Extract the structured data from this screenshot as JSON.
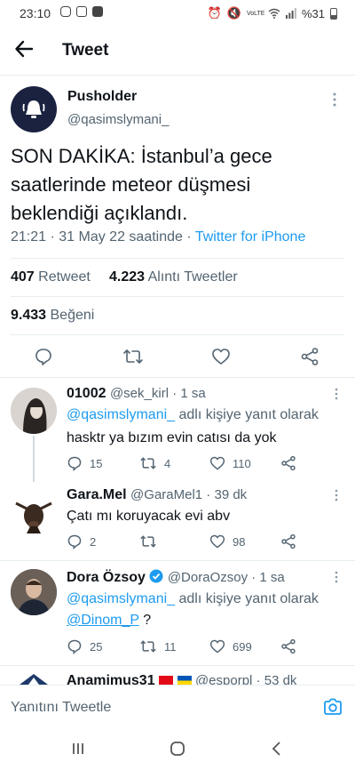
{
  "status_bar": {
    "time": "23:10",
    "network": "VoLTE",
    "battery": "%31"
  },
  "header": {
    "title": "Tweet"
  },
  "tweet": {
    "author_name": "Pusholder",
    "author_handle": "@qasimslymani_",
    "text": "SON DAKİKA: İstanbul’a gece saatlerinde meteor düşmesi beklendiği açıklandı.",
    "time_date": "21:21 · 31 May 22 saatinde · ",
    "source": "Twitter for iPhone",
    "retweets_count": "407",
    "retweets_label": "Retweet",
    "quotes_count": "4.223",
    "quotes_label": "Alıntı Tweetler",
    "likes_count": "9.433",
    "likes_label": "Beğeni"
  },
  "replies": [
    {
      "name": "01002",
      "handle": "@sek_kirl",
      "time": " · 1 sa",
      "reply_to_mention": "@qasimslymani_",
      "reply_to_suffix": " adlı kişiye yanıt olarak",
      "text": "hasktr ya bızım evin catısı da yok",
      "replies": "15",
      "retweets": "4",
      "likes": "110"
    },
    {
      "name": "Gara.Mel",
      "handle": "@GaraMel1",
      "time": " · 39 dk",
      "text": "Çatı mı koruyacak evi abv",
      "replies": "2",
      "retweets": "",
      "likes": "98"
    },
    {
      "name": "Dora Özsoy",
      "handle": "@DoraOzsoy",
      "time": " · 1 sa",
      "reply_to_mention": "@qasimslymani_",
      "reply_to_suffix": " adlı kişiye yanıt olarak",
      "mention2": "@Dinom_P",
      "text_suffix": " ?",
      "replies": "25",
      "retweets": "11",
      "likes": "699"
    },
    {
      "name": "Anamimus31",
      "handle": "@esporpl",
      "time": " · 53 dk"
    }
  ],
  "compose": {
    "placeholder": "Yanıtını Tweetle"
  },
  "colors": {
    "accent": "#1d9bf0",
    "text": "#0f1419",
    "secondary": "#536471",
    "verified": "#1d9bf0"
  },
  "icons": {
    "back": "arrow-left-icon",
    "more": "more-vertical-icon",
    "reply": "comment-icon",
    "retweet": "retweet-icon",
    "like": "heart-icon",
    "share": "share-icon",
    "camera": "camera-icon"
  }
}
